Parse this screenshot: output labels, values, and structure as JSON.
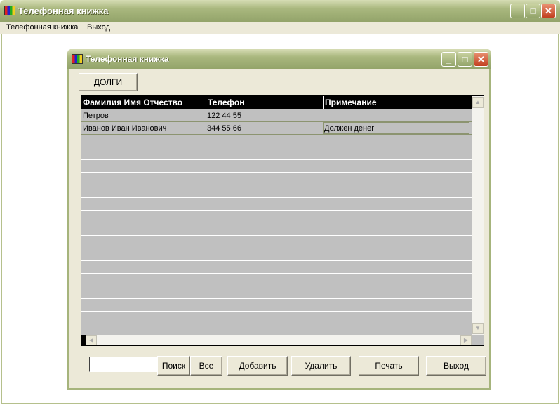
{
  "app": {
    "title": "Телефонная книжка"
  },
  "menu": [
    "Телефонная книжка",
    "Выход"
  ],
  "dialog": {
    "title": "Телефонная  книжка",
    "debts_button": "ДОЛГИ"
  },
  "table": {
    "columns": [
      "Фамилия Имя Отчество",
      "Телефон",
      "Примечание"
    ],
    "rows": [
      {
        "name": "Петров",
        "phone": "122 44 55",
        "note": ""
      },
      {
        "name": "Иванов Иван Иванович",
        "phone": "344 55 66",
        "note": "Должен денег"
      }
    ]
  },
  "search": {
    "value": "",
    "search_button": "Поиск",
    "all_button": "Все"
  },
  "buttons": {
    "add": "Добавить",
    "delete": "Удалить",
    "print": "Печать",
    "exit": "Выход"
  }
}
